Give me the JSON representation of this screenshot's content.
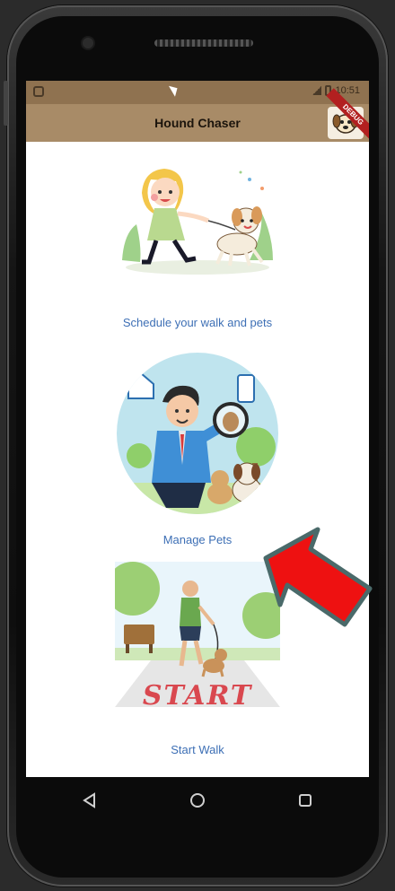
{
  "app": {
    "title": "Hound Chaser",
    "debug_banner": "DEBUG"
  },
  "status_bar": {
    "time": "10:51"
  },
  "menu": [
    {
      "label": "Schedule your walk and pets",
      "illustration": "girl-walking-dog"
    },
    {
      "label": "Manage Pets",
      "illustration": "man-with-magnifying-glass-and-dogs"
    },
    {
      "label": "Start Walk",
      "illustration": "man-walking-dog-start-line",
      "banner_text": "START"
    }
  ],
  "system_nav": [
    "back-icon",
    "home-icon",
    "recents-icon"
  ],
  "colors": {
    "app_bar": "#a88b67",
    "status_bar": "#8f7250",
    "label_blue": "#3d6fb5",
    "arrow_red": "#ee1111"
  }
}
